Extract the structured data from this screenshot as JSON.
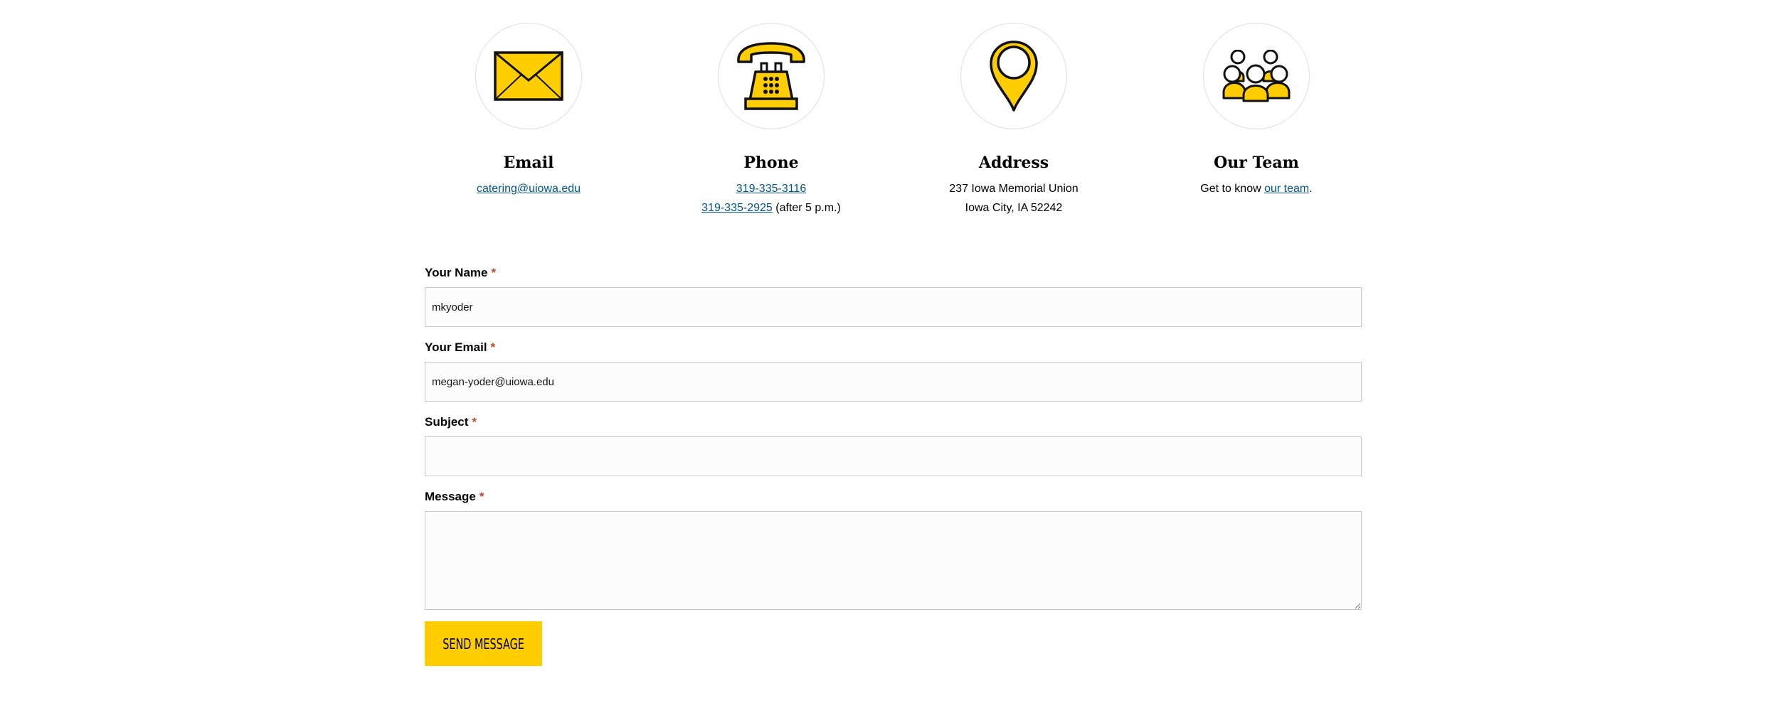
{
  "contact": {
    "email": {
      "heading": "Email",
      "link": "catering@uiowa.edu",
      "icon": "envelope-icon"
    },
    "phone": {
      "heading": "Phone",
      "line1_link": "319-335-3116",
      "line2_link": "319-335-2925",
      "line2_suffix": " (after 5 p.m.)",
      "icon": "telephone-icon"
    },
    "address": {
      "heading": "Address",
      "line1": "237 Iowa Memorial Union",
      "line2": "Iowa City, IA 52242",
      "icon": "map-pin-icon"
    },
    "team": {
      "heading": "Our Team",
      "prefix": "Get to know ",
      "link": "our team",
      "suffix": ".",
      "icon": "team-icon"
    }
  },
  "form": {
    "name": {
      "label": "Your Name",
      "required_mark": "*",
      "value": "mkyoder"
    },
    "email": {
      "label": "Your Email",
      "required_mark": "*",
      "value": "megan-yoder@uiowa.edu"
    },
    "subject": {
      "label": "Subject",
      "required_mark": "*",
      "value": ""
    },
    "message": {
      "label": "Message",
      "required_mark": "*",
      "value": ""
    },
    "submit_label": "SEND MESSAGE"
  },
  "colors": {
    "accent": "#ffcd00",
    "link": "#00558c",
    "required": "#bd472a"
  }
}
